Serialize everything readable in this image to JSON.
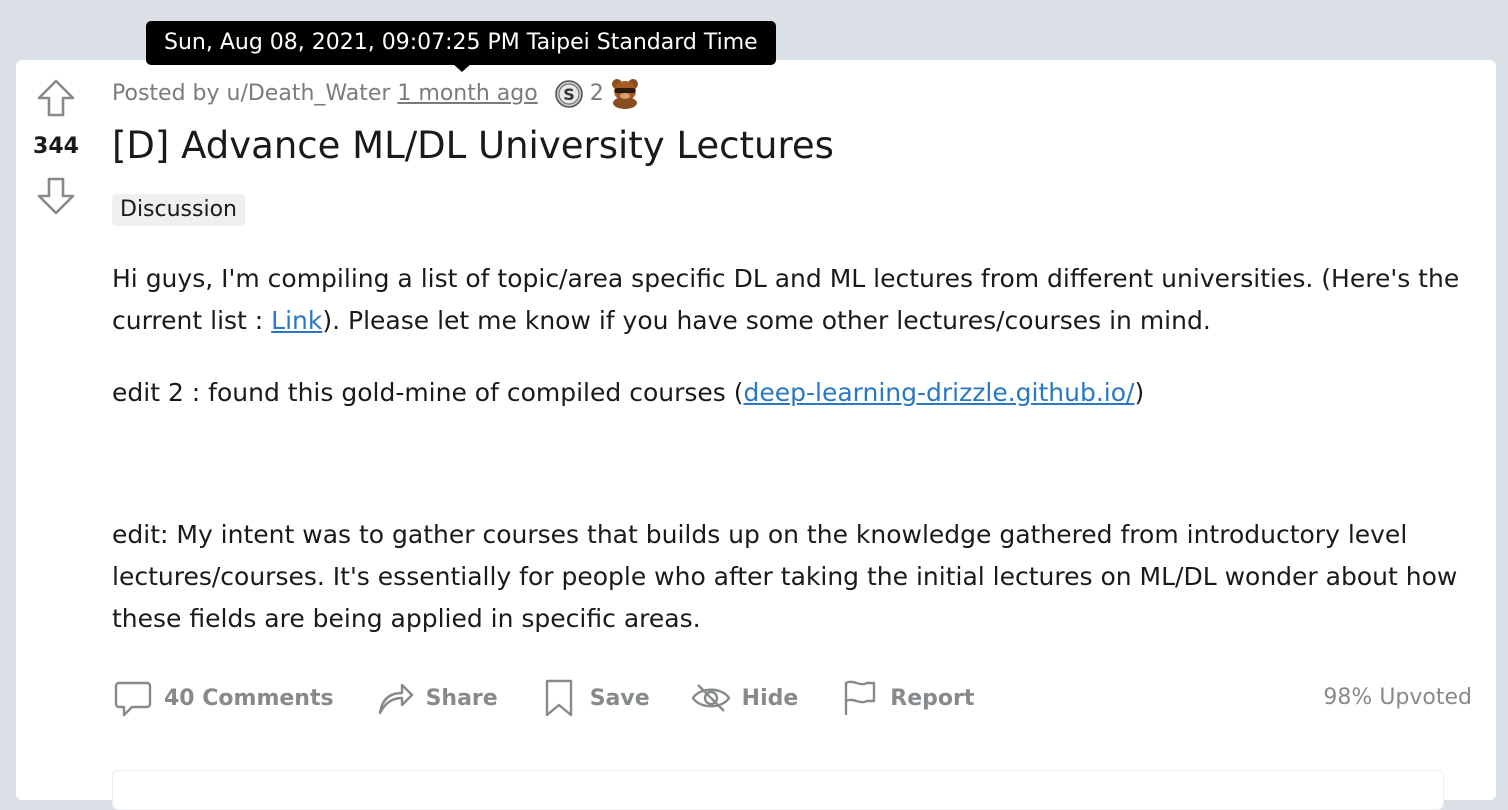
{
  "tooltip": {
    "text": "Sun, Aug 08, 2021, 09:07:25 PM Taipei Standard Time"
  },
  "post": {
    "score": "344",
    "meta": {
      "posted_by": "Posted by u/Death_Water",
      "time": "1 month ago",
      "award_icon": "silver-award-icon",
      "award_count": "2",
      "bear_icon": "bear-award-icon"
    },
    "title": "[D] Advance ML/DL University Lectures",
    "flair": "Discussion",
    "body": {
      "p1_before": "Hi guys, I'm compiling a list of topic/area specific DL and ML lectures from different universities. (Here's the current list : ",
      "p1_link": "Link",
      "p1_after": "). Please let me know if you have some other lectures/courses in mind.",
      "p2_before": "edit 2 : found this gold-mine of compiled courses (",
      "p2_link": "deep-learning-drizzle.github.io/",
      "p2_after": ")",
      "p3": "edit: My intent was to gather courses that builds up on the knowledge gathered from introductory level lectures/courses. It's essentially for people who after taking the initial lectures on ML/DL wonder about how these fields are being applied in specific areas."
    },
    "actions": {
      "comments": "40 Comments",
      "share": "Share",
      "save": "Save",
      "hide": "Hide",
      "report": "Report",
      "upvoted": "98% Upvoted"
    }
  },
  "colors": {
    "page_bg": "#dae0e6",
    "card_bg": "#ffffff",
    "link": "#2b78c2",
    "muted": "#878a8c",
    "text": "#1a1a1b"
  }
}
